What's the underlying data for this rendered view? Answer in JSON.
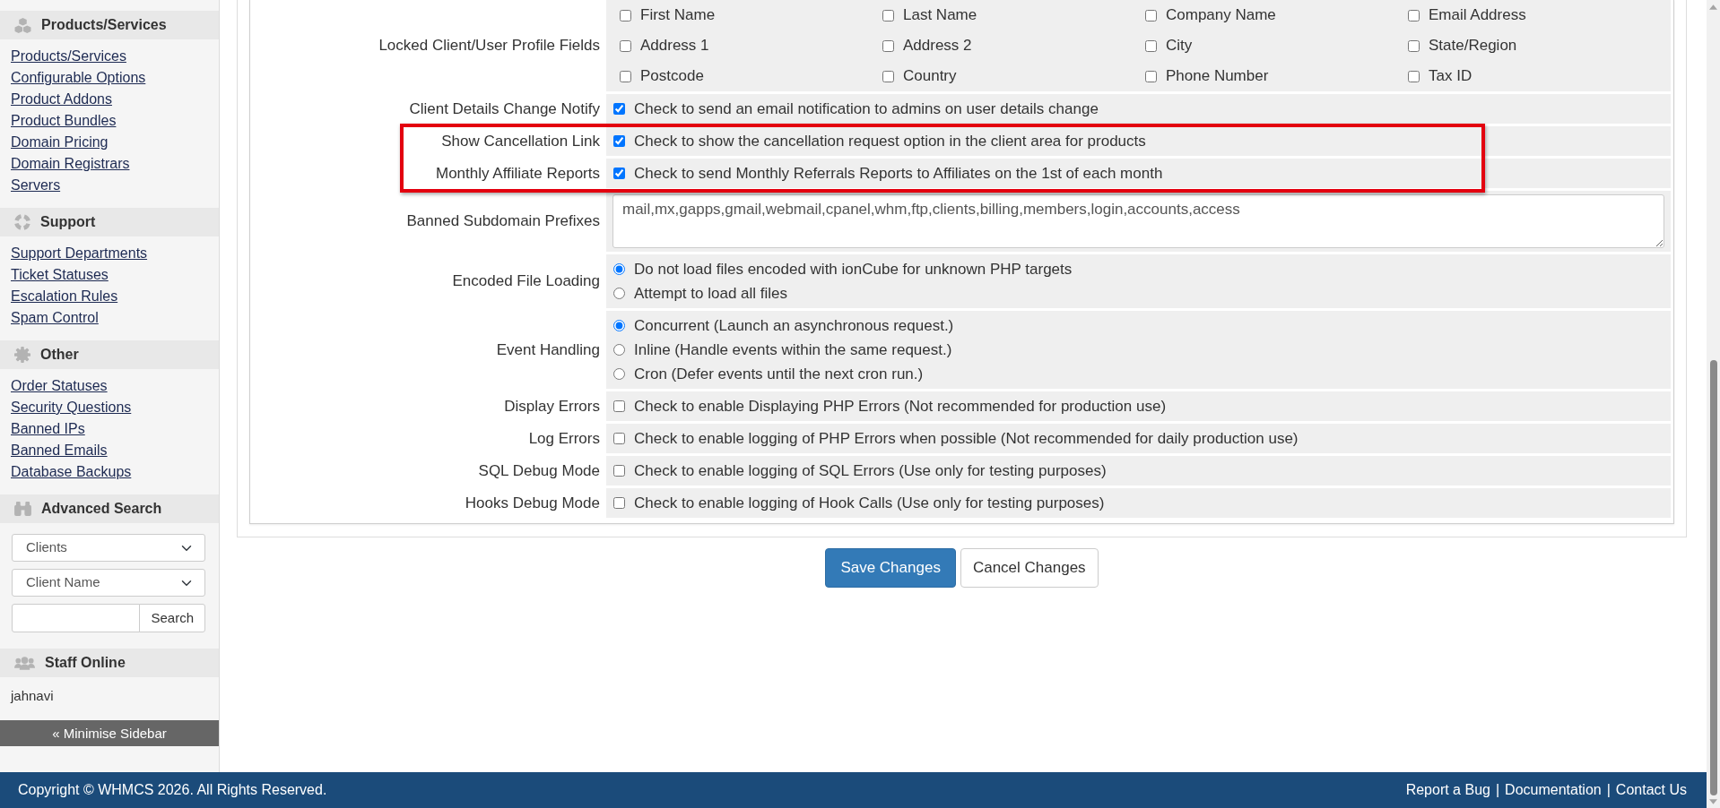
{
  "sidebar": {
    "sections": [
      {
        "title": "Products/Services",
        "links": [
          "Products/Services",
          "Configurable Options",
          "Product Addons",
          "Product Bundles",
          "Domain Pricing",
          "Domain Registrars",
          "Servers"
        ]
      },
      {
        "title": "Support",
        "links": [
          "Support Departments",
          "Ticket Statuses",
          "Escalation Rules",
          "Spam Control"
        ]
      },
      {
        "title": "Other",
        "links": [
          "Order Statuses",
          "Security Questions",
          "Banned IPs",
          "Banned Emails",
          "Database Backups"
        ]
      }
    ],
    "advanced_search": {
      "title": "Advanced Search",
      "selects": [
        "Clients",
        "Client Name"
      ],
      "search_button": "Search"
    },
    "staff_online": {
      "title": "Staff Online",
      "staff": [
        "jahnavi"
      ]
    },
    "minimise_button": "« Minimise Sidebar"
  },
  "settings": {
    "rows": [
      {
        "kind": "checkbox-grid",
        "label": "Locked Client/User Profile Fields",
        "highlighted": false,
        "options": [
          {
            "label": "First Name",
            "checked": false
          },
          {
            "label": "Last Name",
            "checked": false
          },
          {
            "label": "Company Name",
            "checked": false
          },
          {
            "label": "Email Address",
            "checked": false
          },
          {
            "label": "Address 1",
            "checked": false
          },
          {
            "label": "Address 2",
            "checked": false
          },
          {
            "label": "City",
            "checked": false
          },
          {
            "label": "State/Region",
            "checked": false
          },
          {
            "label": "Postcode",
            "checked": false
          },
          {
            "label": "Country",
            "checked": false
          },
          {
            "label": "Phone Number",
            "checked": false
          },
          {
            "label": "Tax ID",
            "checked": false
          }
        ]
      },
      {
        "kind": "checkbox",
        "label": "Client Details Change Notify",
        "highlighted": false,
        "checked": true,
        "text": "Check to send an email notification to admins on user details change"
      },
      {
        "kind": "checkbox",
        "label": "Show Cancellation Link",
        "highlighted": true,
        "checked": true,
        "text": "Check to show the cancellation request option in the client area for products"
      },
      {
        "kind": "checkbox",
        "label": "Monthly Affiliate Reports",
        "highlighted": true,
        "checked": true,
        "text": "Check to send Monthly Referrals Reports to Affiliates on the 1st of each month"
      },
      {
        "kind": "textarea",
        "label": "Banned Subdomain Prefixes",
        "highlighted": false,
        "value": "mail,mx,gapps,gmail,webmail,cpanel,whm,ftp,clients,billing,members,login,accounts,access"
      },
      {
        "kind": "radios",
        "label": "Encoded File Loading",
        "highlighted": false,
        "options": [
          {
            "label": "Do not load files encoded with ionCube for unknown PHP targets",
            "selected": true
          },
          {
            "label": "Attempt to load all files",
            "selected": false
          }
        ]
      },
      {
        "kind": "radios",
        "label": "Event Handling",
        "highlighted": false,
        "options": [
          {
            "label": "Concurrent (Launch an asynchronous request.)",
            "selected": true
          },
          {
            "label": "Inline (Handle events within the same request.)",
            "selected": false
          },
          {
            "label": "Cron (Defer events until the next cron run.)",
            "selected": false
          }
        ]
      },
      {
        "kind": "checkbox",
        "label": "Display Errors",
        "highlighted": false,
        "checked": false,
        "text": "Check to enable Displaying PHP Errors (Not recommended for production use)"
      },
      {
        "kind": "checkbox",
        "label": "Log Errors",
        "highlighted": false,
        "checked": false,
        "text": "Check to enable logging of PHP Errors when possible (Not recommended for daily production use)"
      },
      {
        "kind": "checkbox",
        "label": "SQL Debug Mode",
        "highlighted": false,
        "checked": false,
        "text": "Check to enable logging of SQL Errors (Use only for testing purposes)"
      },
      {
        "kind": "checkbox",
        "label": "Hooks Debug Mode",
        "highlighted": false,
        "checked": false,
        "text": "Check to enable logging of Hook Calls (Use only for testing purposes)"
      }
    ]
  },
  "buttons": [
    {
      "label": "Save Changes",
      "kind": "primary"
    },
    {
      "label": "Cancel Changes",
      "kind": "default"
    }
  ],
  "footer": {
    "copyright": "Copyright © WHMCS 2026. All Rights Reserved.",
    "links": [
      "Report a Bug",
      "Documentation",
      "Contact Us"
    ],
    "separator": "|"
  }
}
